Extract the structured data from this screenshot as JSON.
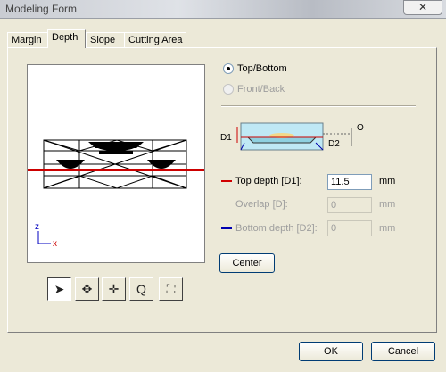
{
  "window": {
    "title": "Modeling Form",
    "close_glyph": "✕"
  },
  "tabs": [
    {
      "label": "Margin"
    },
    {
      "label": "Depth"
    },
    {
      "label": "Slope"
    },
    {
      "label": "Cutting Area"
    }
  ],
  "view_options": {
    "top_bottom": "Top/Bottom",
    "front_back": "Front/Back"
  },
  "diagram": {
    "d1": "D1",
    "d2": "D2",
    "origin": "O"
  },
  "depth": {
    "top_label": "Top depth [D1]:",
    "top_value": "11.5",
    "overlap_label": "Overlap [D]:",
    "overlap_value": "0",
    "bottom_label": "Bottom depth [D2]:",
    "bottom_value": "0",
    "unit": "mm"
  },
  "axes": {
    "z": "z",
    "x": "x"
  },
  "center_button": "Center",
  "toolbar": [
    {
      "icon": "select-arrow-icon",
      "glyph": "➤"
    },
    {
      "icon": "rotate-icon",
      "glyph": "✥"
    },
    {
      "icon": "pan-icon",
      "glyph": "✛"
    },
    {
      "icon": "zoom-icon",
      "glyph": "Q"
    },
    {
      "icon": "fit-view-icon",
      "glyph": "⛶"
    }
  ],
  "footer": {
    "ok": "OK",
    "cancel": "Cancel"
  },
  "colors": {
    "top_marker": "#d00000",
    "bottom_marker": "#0000b0",
    "model_red": "#cc0000"
  }
}
